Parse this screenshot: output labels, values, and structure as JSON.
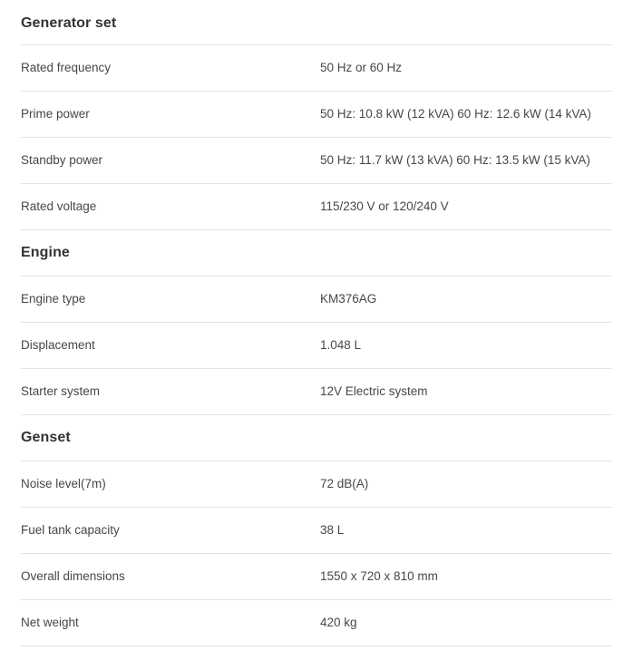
{
  "document": {
    "type": "specification-table",
    "background_color": "#ffffff",
    "text_color": "#474747",
    "heading_color": "#333333",
    "divider_color": "#e3e3e3"
  },
  "sections": [
    {
      "heading": "Generator set",
      "rows": [
        {
          "label": "Rated frequency",
          "value": "50 Hz or 60 Hz"
        },
        {
          "label": "Prime power",
          "value": "50 Hz: 10.8 kW (12 kVA) 60 Hz: 12.6 kW (14 kVA)"
        },
        {
          "label": "Standby power",
          "value": "50 Hz: 11.7 kW (13 kVA) 60 Hz: 13.5 kW (15 kVA)"
        },
        {
          "label": "Rated voltage",
          "value": "115/230 V or 120/240 V"
        }
      ]
    },
    {
      "heading": "Engine",
      "rows": [
        {
          "label": "Engine type",
          "value": "KM376AG"
        },
        {
          "label": "Displacement",
          "value": "1.048 L"
        },
        {
          "label": "Starter system",
          "value": "12V Electric system"
        }
      ]
    },
    {
      "heading": "Genset",
      "rows": [
        {
          "label": "Noise level(7m)",
          "value": "72 dB(A)"
        },
        {
          "label": "Fuel tank capacity",
          "value": "38 L"
        },
        {
          "label": "Overall dimensions",
          "value": "1550 x 720 x 810 mm"
        },
        {
          "label": "Net weight",
          "value": "420 kg"
        }
      ]
    }
  ]
}
